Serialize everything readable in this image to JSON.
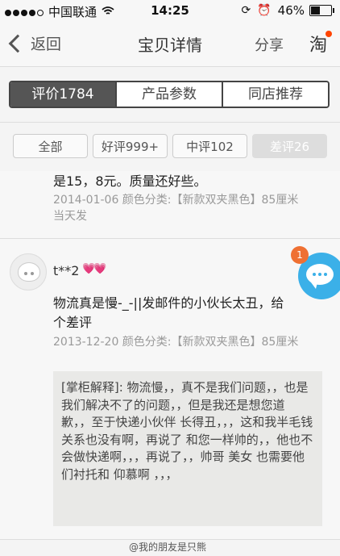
{
  "status": {
    "carrier": "中国联通",
    "time": "14:25",
    "battery": "46%",
    "battery_level": 0.46
  },
  "nav": {
    "back_label": "返回",
    "title": "宝贝详情",
    "share_label": "分享",
    "tao_label": "淘"
  },
  "tabs": [
    "评价1784",
    "产品参数",
    "同店推荐"
  ],
  "filters": [
    "全部",
    "好评999+",
    "中评102",
    "差评26"
  ],
  "review1": {
    "text": "是15，8元。质量还好些。",
    "meta_line1": "2014-01-06 颜色分类:【新款双夹黑色】85厘米",
    "meta_line2": "当天发"
  },
  "review2": {
    "user": "t**2",
    "hearts": "💗💗",
    "text_line1": "物流真是慢-_-||发邮件的小伙长太丑，给",
    "text_line2": "个差评",
    "meta": "2013-12-20 颜色分类:【新款双夹黑色】85厘米",
    "seller_reply": "[掌柜解释]: 物流慢，，真不是我们问题，，也是我们解决不了的问题，，但是我还是想您道歉，，至于快递小伙伴 长得丑，，，这和我半毛钱关系也没有啊，再说了 和您一样帅的，，他也不会做快递啊，，，再说了，，帅哥 美女 也需要他们衬托和 仰慕啊 ，，，"
  },
  "chat": {
    "badge": "1"
  },
  "watermark": "@我的朋友是只熊"
}
